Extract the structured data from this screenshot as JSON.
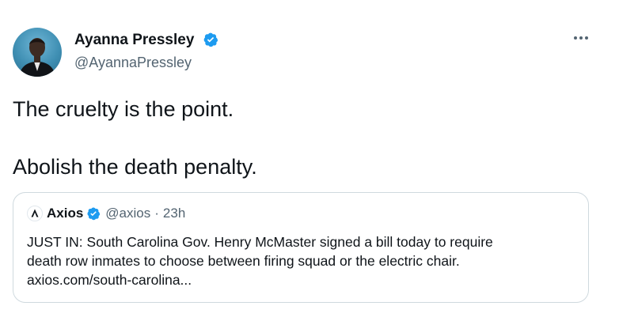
{
  "author": {
    "name": "Ayanna Pressley",
    "handle": "@AyannaPressley",
    "verified_icon": "verified-badge-icon",
    "more_icon": "more-horizontal-icon"
  },
  "tweet": {
    "line1": "The cruelty is the point.",
    "line2": "Abolish the death penalty."
  },
  "quoted": {
    "logo_icon": "axios-logo-icon",
    "name": "Axios",
    "handle": "@axios",
    "separator": "·",
    "time": "23h",
    "text_lines": [
      "JUST IN: South Carolina Gov. Henry McMaster signed a bill today to require",
      "death row inmates to choose between firing squad or the electric chair.",
      "axios.com/south-carolina..."
    ]
  },
  "colors": {
    "text": "#0f1419",
    "secondary": "#536471",
    "verified": "#1d9bf0",
    "border": "#cfd9de"
  }
}
